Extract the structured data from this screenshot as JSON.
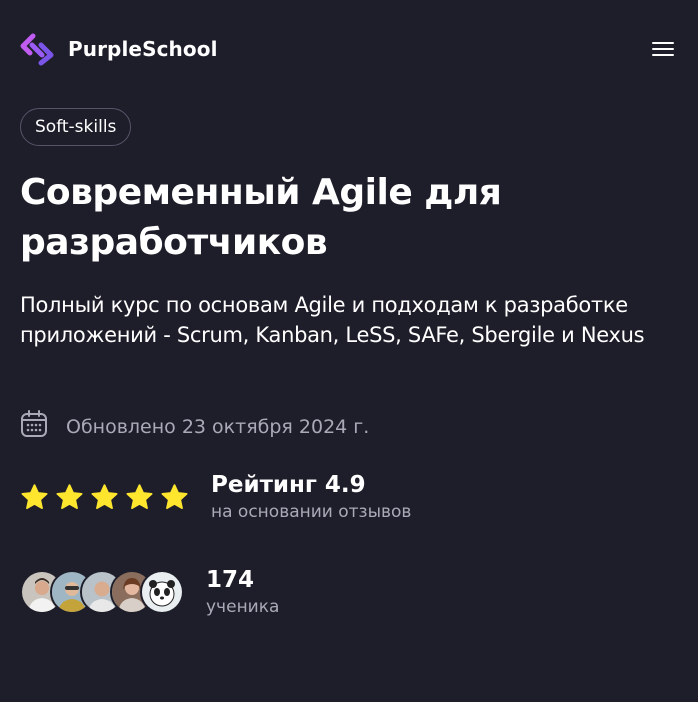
{
  "header": {
    "brand_name": "PurpleSchool",
    "logo_icon": "purple-school-logo",
    "menu_icon": "hamburger-menu-icon"
  },
  "course": {
    "tag": "Soft-skills",
    "title": "Современный Agile для разработчиков",
    "subtitle": "Полный курс по основам Agile и подходам к разработке приложений - Scrum, Kanban, LeSS, SAFe, Sbergile и Nexus",
    "updated": "Обновлено 23 октября 2024 г.",
    "updated_icon": "calendar-icon"
  },
  "rating": {
    "title": "Рейтинг 4.9",
    "subtitle": "на основании отзывов",
    "stars": 5,
    "star_color": "#ffe62e"
  },
  "students": {
    "count": "174",
    "label": "ученика",
    "avatars": [
      "avatar-1",
      "avatar-2",
      "avatar-3",
      "avatar-4",
      "avatar-5"
    ]
  },
  "colors": {
    "background": "#1e1e2a",
    "accent_purple": "#9b5cf6",
    "muted_text": "#a9a9b8"
  }
}
